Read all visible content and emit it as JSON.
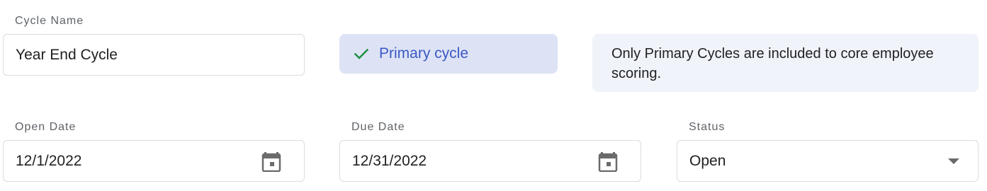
{
  "cycle_name": {
    "label": "Cycle Name",
    "value": "Year End Cycle"
  },
  "primary_cycle": {
    "label": "Primary cycle",
    "checked": true,
    "check_icon": "check-icon",
    "check_color": "#1e8e3e",
    "accent_color": "#3c59c4",
    "background_color": "#dde3f5"
  },
  "info": {
    "text": "Only Primary Cycles are included to core employee scoring."
  },
  "open_date": {
    "label": "Open Date",
    "value": "12/1/2022",
    "icon": "calendar-icon"
  },
  "due_date": {
    "label": "Due Date",
    "value": "12/31/2022",
    "icon": "calendar-icon"
  },
  "status": {
    "label": "Status",
    "value": "Open",
    "icon": "dropdown-arrow-icon"
  }
}
